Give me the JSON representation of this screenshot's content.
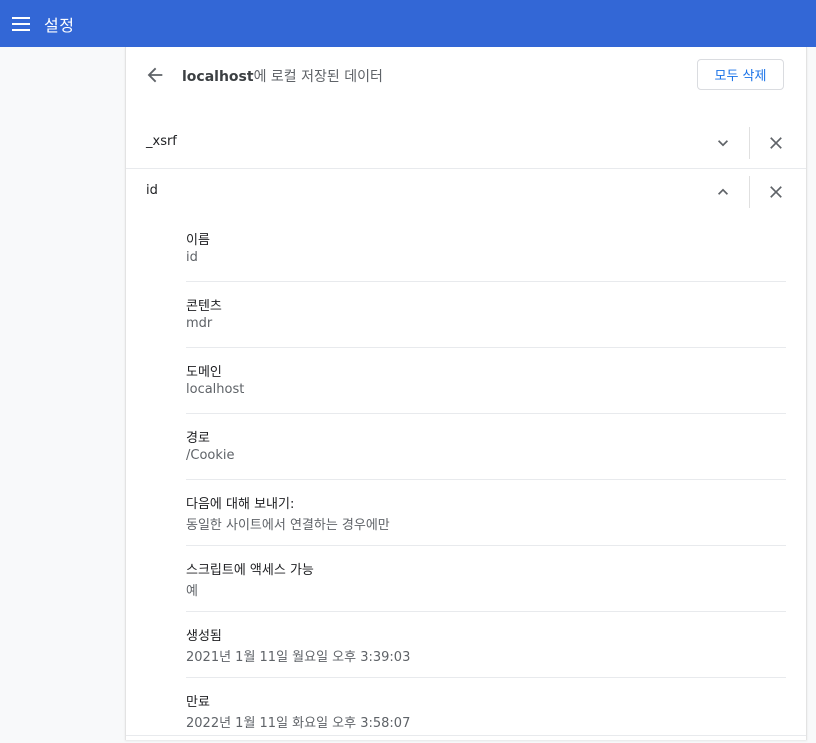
{
  "header": {
    "app_title": "설정",
    "menu_icon": "hamburger-menu-icon"
  },
  "subpage": {
    "title_bold": "localhost",
    "title_rest": "에 로컬 저장된 데이터",
    "remove_all_label": "모두 삭제"
  },
  "cookies": [
    {
      "name": "_xsrf",
      "expanded": false
    },
    {
      "name": "id",
      "expanded": true
    }
  ],
  "details": [
    {
      "label": "이름",
      "value": "id"
    },
    {
      "label": "콘텐츠",
      "value": "mdr"
    },
    {
      "label": "도메인",
      "value": "localhost"
    },
    {
      "label": "경로",
      "value": "/Cookie"
    },
    {
      "label": "다음에 대해 보내기:",
      "value": "동일한 사이트에서 연결하는 경우에만"
    },
    {
      "label": "스크립트에 액세스 가능",
      "value": "예"
    },
    {
      "label": "생성됨",
      "value": "2021년 1월 11일 월요일 오후 3:39:03"
    },
    {
      "label": "만료",
      "value": "2022년 1월 11일 화요일 오후 3:58:07"
    }
  ],
  "colors": {
    "topbar": "#3367d6",
    "accent": "#1a73e8"
  }
}
